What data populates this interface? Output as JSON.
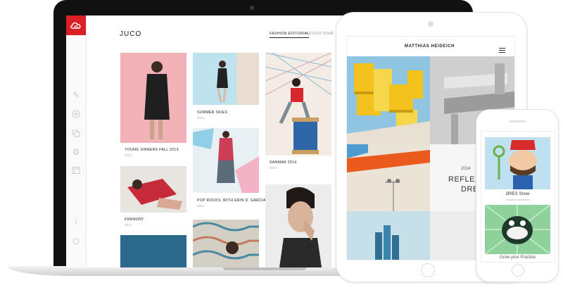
{
  "laptop": {
    "site_title": "JUCO",
    "nav": [
      "FASHION EDITORIAL",
      "ADVERTISING",
      "F"
    ],
    "rail_icons": [
      "pencil-icon",
      "add-icon",
      "stack-icon",
      "gear-icon",
      "layout-icon",
      "info-icon",
      "power-icon"
    ],
    "tiles": [
      {
        "title": "YOUNG SINNERS FALL 2013",
        "year": "2013"
      },
      {
        "title": "SUMMER SKIES",
        "year": "2014"
      },
      {
        "title": "SANMAR 2014",
        "year": "2014"
      },
      {
        "title": "POP ROCKS, WITH ERIN D. GARCIA",
        "year": "2014"
      },
      {
        "title": "FREMONT",
        "year": "2014"
      }
    ]
  },
  "tablet": {
    "site_title": "MATTHIAS HEIDEICH",
    "year": "2014",
    "caption_line1": "REFLEXIC",
    "caption_line2": "DRE"
  },
  "phone": {
    "title": "3RIES Show",
    "subtitle": "Character Illustrations",
    "footer": "Grow your Practice"
  },
  "colors": {
    "brand_red": "#da1f26",
    "laptop_bezel": "#111111"
  }
}
